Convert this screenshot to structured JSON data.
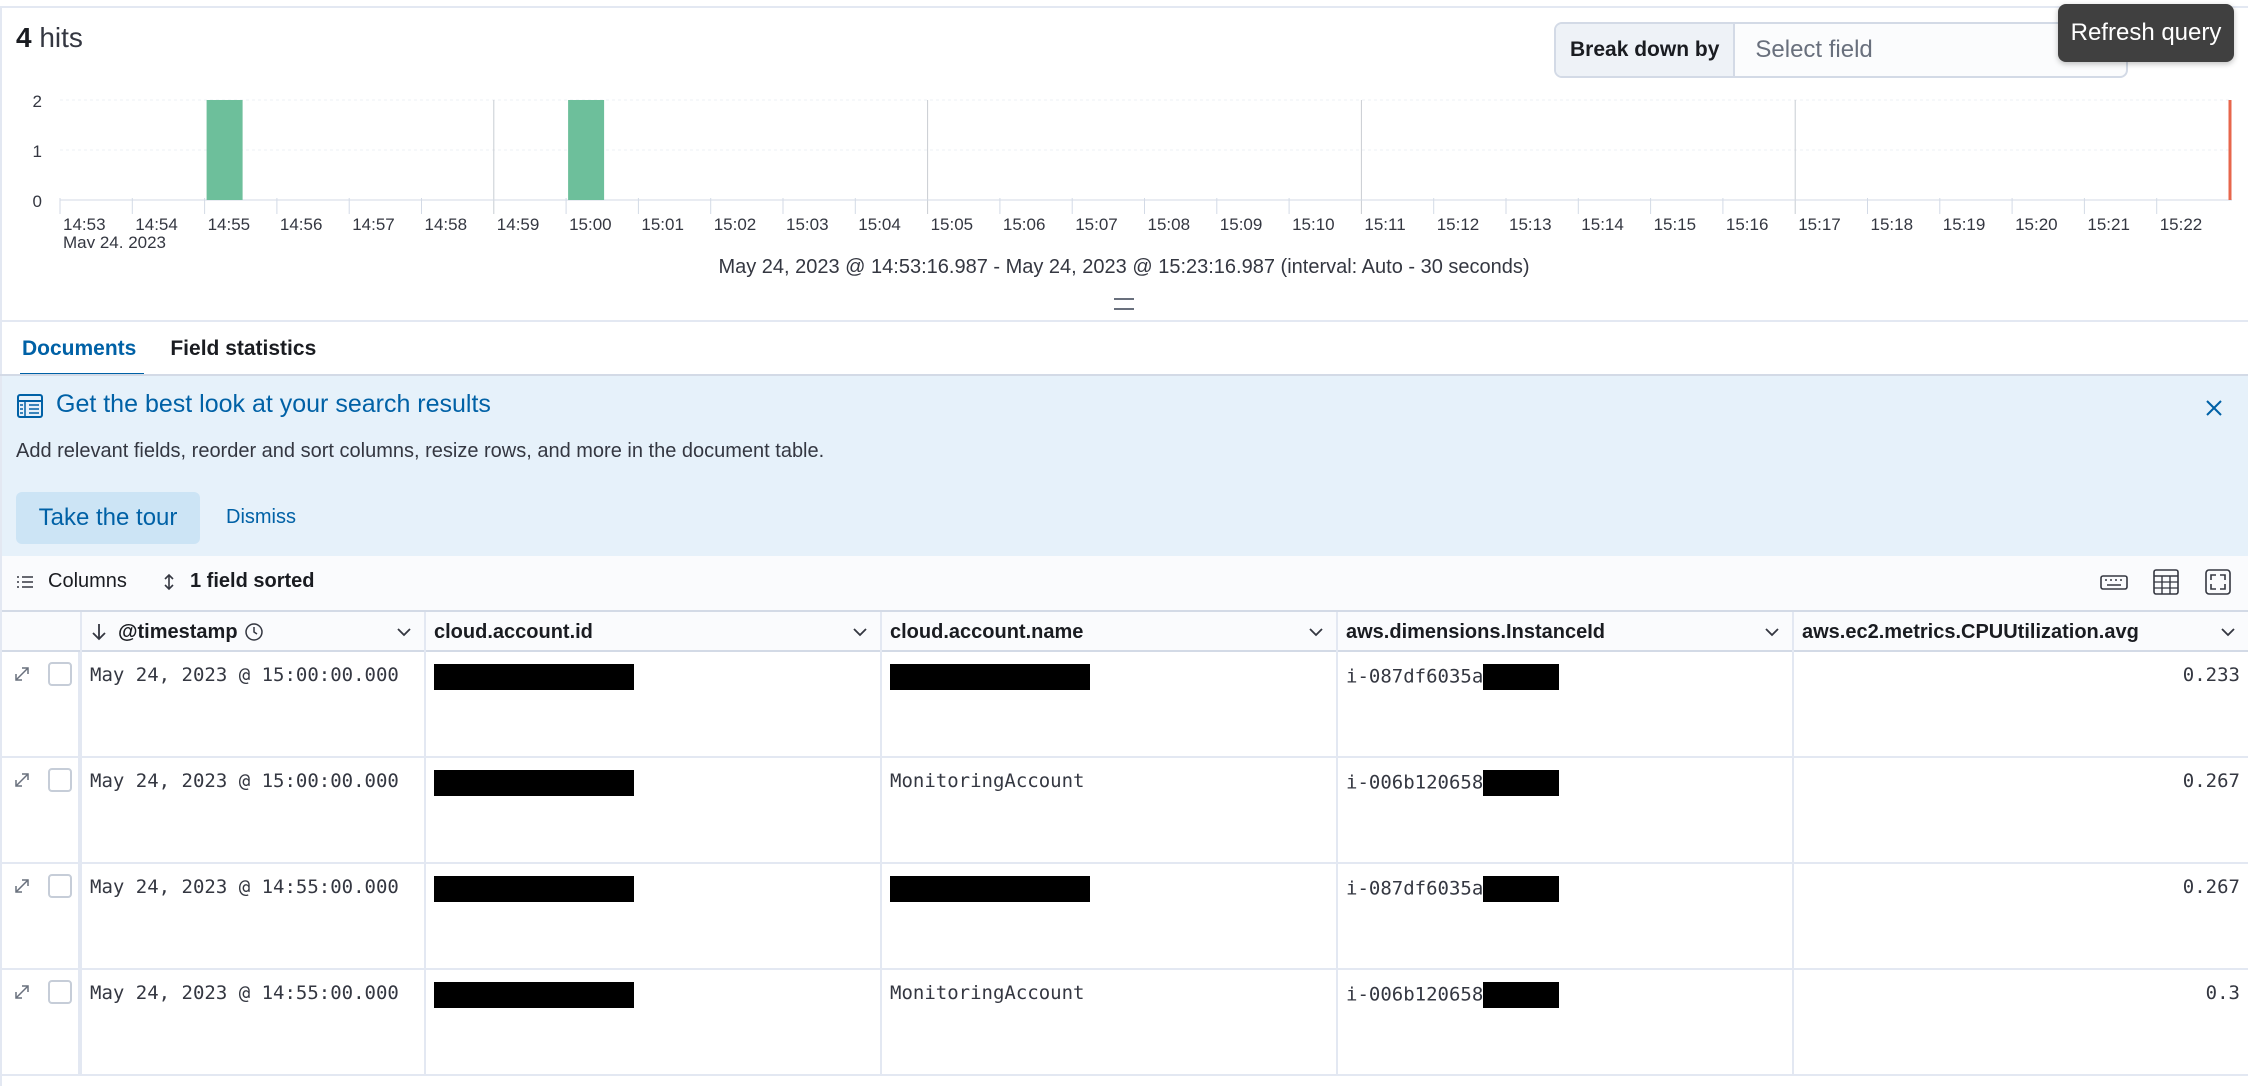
{
  "header": {
    "hits_count": "4",
    "hits_label": "hits",
    "breakdown_label": "Break down by",
    "breakdown_placeholder": "Select field",
    "tooltip": "Refresh query"
  },
  "histogram": {
    "y_ticks": [
      "0",
      "1",
      "2"
    ],
    "x_ticks": [
      "14:53",
      "14:54",
      "14:55",
      "14:56",
      "14:57",
      "14:58",
      "14:59",
      "15:00",
      "15:01",
      "15:02",
      "15:03",
      "15:04",
      "15:05",
      "15:06",
      "15:07",
      "15:08",
      "15:09",
      "15:10",
      "15:11",
      "15:12",
      "15:13",
      "15:14",
      "15:15",
      "15:16",
      "15:17",
      "15:18",
      "15:19",
      "15:20",
      "15:21",
      "15:22"
    ],
    "date_label": "May 24, 2023",
    "bars": [
      {
        "x": "14:55",
        "value": 2
      },
      {
        "x": "15:00",
        "value": 2
      }
    ],
    "y_max": 2,
    "bar_color": "#6dbf9b",
    "marker_color": "#e7664c",
    "range_text": "May 24, 2023 @ 14:53:16.987 - May 24, 2023 @ 15:23:16.987 (interval: Auto - 30 seconds)"
  },
  "tabs": [
    {
      "label": "Documents",
      "active": true
    },
    {
      "label": "Field statistics",
      "active": false
    }
  ],
  "callout": {
    "title": "Get the best look at your search results",
    "description": "Add relevant fields, reorder and sort columns, resize rows, and more in the document table.",
    "primary_button": "Take the tour",
    "secondary_button": "Dismiss"
  },
  "toolbar": {
    "columns_label": "Columns",
    "sorted_label": "1 field sorted"
  },
  "table": {
    "columns": [
      "@timestamp",
      "cloud.account.id",
      "cloud.account.name",
      "aws.dimensions.InstanceId",
      "aws.ec2.metrics.CPUUtilization.avg"
    ],
    "rows": [
      {
        "timestamp": "May 24, 2023 @ 15:00:00.000",
        "account_name": "",
        "instance_id": "i-087df6035a",
        "cpu": "0.233"
      },
      {
        "timestamp": "May 24, 2023 @ 15:00:00.000",
        "account_name": "MonitoringAccount",
        "instance_id": "i-006b120658",
        "cpu": "0.267"
      },
      {
        "timestamp": "May 24, 2023 @ 14:55:00.000",
        "account_name": "",
        "instance_id": "i-087df6035a",
        "cpu": "0.267"
      },
      {
        "timestamp": "May 24, 2023 @ 14:55:00.000",
        "account_name": "MonitoringAccount",
        "instance_id": "i-006b120658",
        "cpu": "0.3"
      }
    ]
  }
}
